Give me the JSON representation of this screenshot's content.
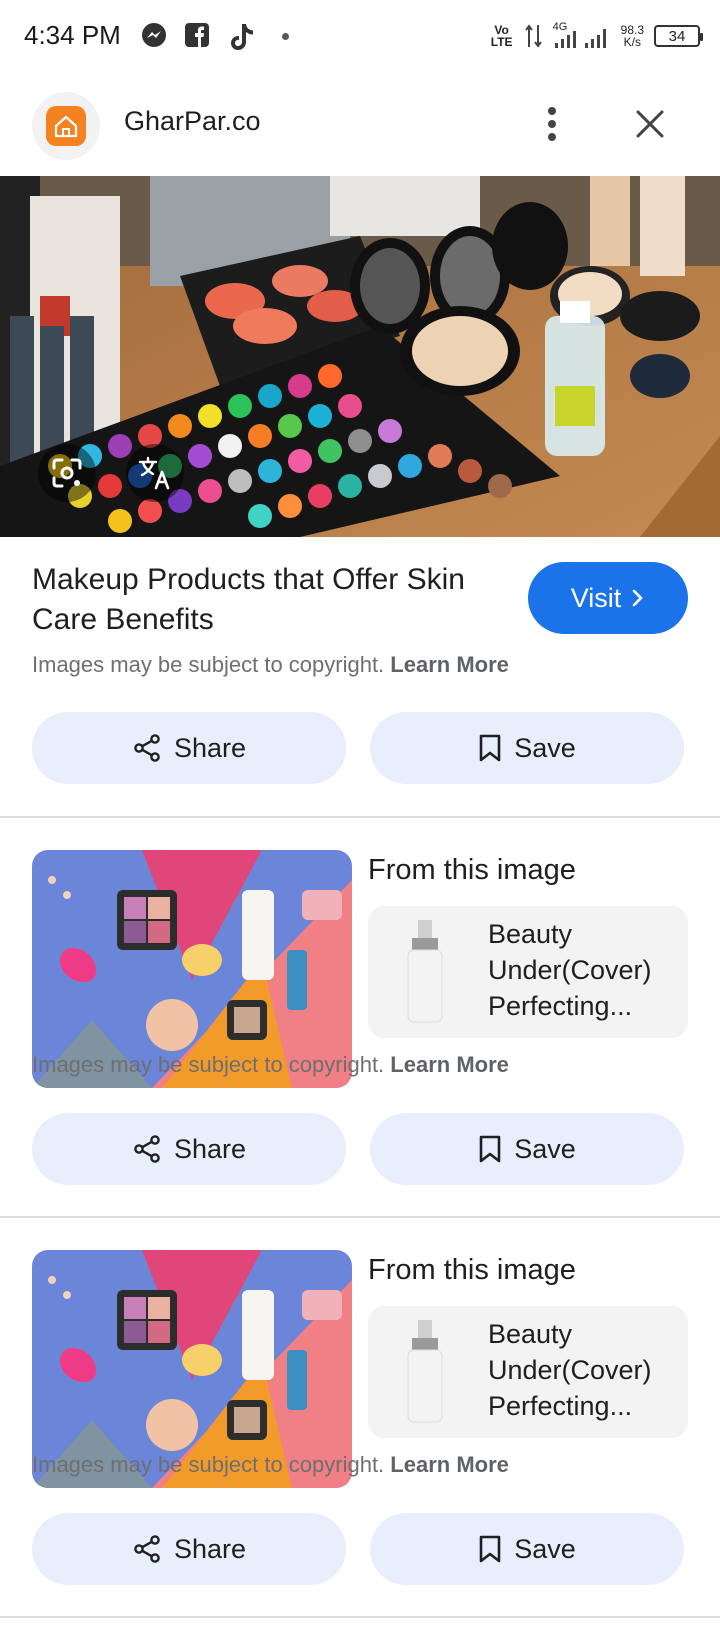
{
  "status_bar": {
    "time": "4:34 PM",
    "network_type": "Vo LTE",
    "network_gen": "4G",
    "speed_value": "98.3",
    "speed_unit": "K/s",
    "battery": "34"
  },
  "header": {
    "site_name": "GharPar.co"
  },
  "result": {
    "title": "Makeup Products that Offer Skin Care Benefits",
    "visit_label": "Visit",
    "copyright_text": "Images may be subject to copyright.",
    "learn_more": "Learn More",
    "share_label": "Share",
    "save_label": "Save"
  },
  "related": [
    {
      "from_label": "From this image",
      "product_name": "Beauty Under(Cover) Perfecting...",
      "copyright_text": "Images may be subject to copyright.",
      "learn_more": "Learn More",
      "share_label": "Share",
      "save_label": "Save"
    },
    {
      "from_label": "From this image",
      "product_name": "Beauty Under(Cover) Perfecting...",
      "copyright_text": "Images may be subject to copyright.",
      "learn_more": "Learn More",
      "share_label": "Share",
      "save_label": "Save"
    }
  ],
  "icons": {
    "status": [
      "messenger-icon",
      "facebook-icon",
      "tiktok-icon",
      "signal-icon",
      "battery-icon"
    ],
    "header": [
      "site-logo-icon",
      "more-vert-icon",
      "close-icon"
    ],
    "overlay": [
      "lens-icon",
      "translate-icon"
    ],
    "actions": [
      "share-icon",
      "bookmark-icon",
      "chevron-right-icon"
    ]
  },
  "colors": {
    "accent": "#1a73e8",
    "action_button_bg": "#e8eefb",
    "logo_orange": "#f58220",
    "divider": "#dadce0"
  }
}
